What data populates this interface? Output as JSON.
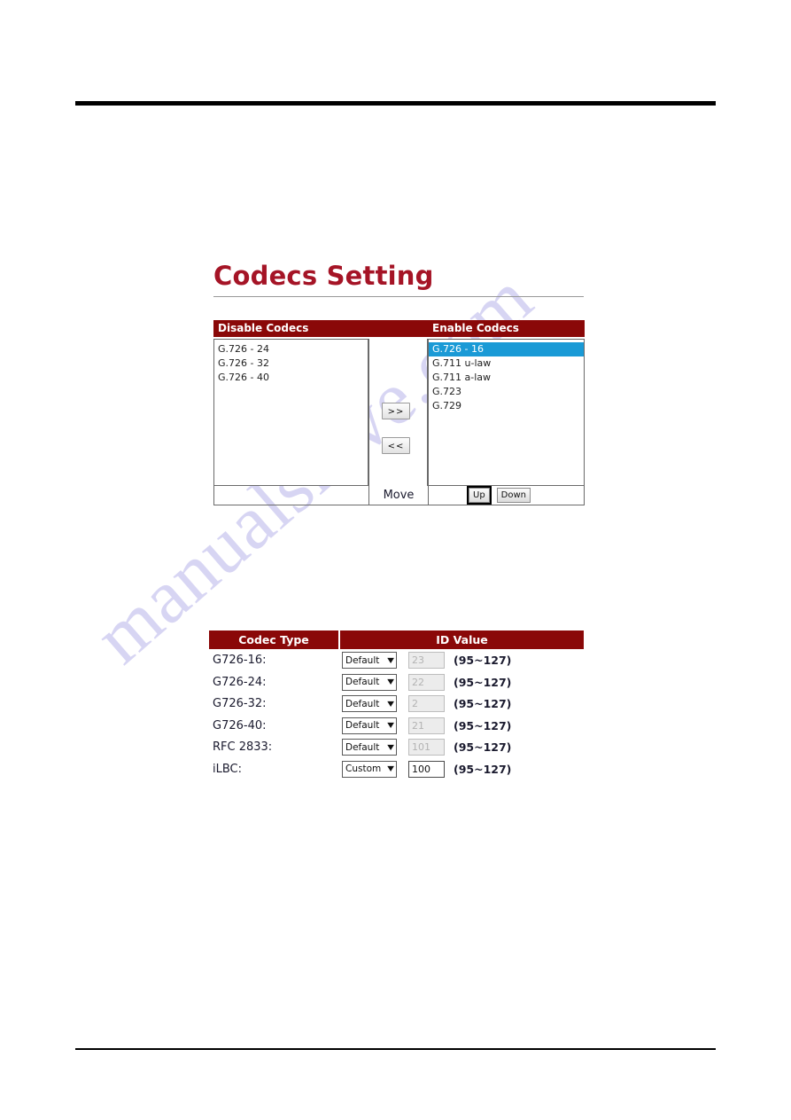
{
  "page": {
    "title": "Codecs Setting",
    "title_color": "#a51426",
    "header_bg": "#8a0808",
    "selection_color": "#1a9ad6",
    "watermark": "manualshive.com"
  },
  "transfer": {
    "headers": {
      "disable": "Disable Codecs",
      "middle": "",
      "enable": "Enable Codecs"
    },
    "disable_list": [
      {
        "label": "G.726 - 24",
        "selected": false
      },
      {
        "label": "G.726 - 32",
        "selected": false
      },
      {
        "label": "G.726 - 40",
        "selected": false
      }
    ],
    "enable_list": [
      {
        "label": "G.726 - 16",
        "selected": true
      },
      {
        "label": "G.711 u-law",
        "selected": false
      },
      {
        "label": "G.711 a-law",
        "selected": false
      },
      {
        "label": "G.723",
        "selected": false
      },
      {
        "label": "G.729",
        "selected": false
      }
    ],
    "buttons": {
      "forward": ">>",
      "backward": "<<",
      "move_label": "Move",
      "up": "Up",
      "down": "Down"
    }
  },
  "id_table": {
    "headers": {
      "codec_type": "Codec Type",
      "id_value": "ID Value"
    },
    "rows": [
      {
        "codec": "G726-16:",
        "mode": "Default",
        "id": "23",
        "id_enabled": false,
        "range": "(95~127)"
      },
      {
        "codec": "G726-24:",
        "mode": "Default",
        "id": "22",
        "id_enabled": false,
        "range": "(95~127)"
      },
      {
        "codec": "G726-32:",
        "mode": "Default",
        "id": "2",
        "id_enabled": false,
        "range": "(95~127)"
      },
      {
        "codec": "G726-40:",
        "mode": "Default",
        "id": "21",
        "id_enabled": false,
        "range": "(95~127)"
      },
      {
        "codec": "RFC 2833:",
        "mode": "Default",
        "id": "101",
        "id_enabled": false,
        "range": "(95~127)"
      },
      {
        "codec": "iLBC:",
        "mode": "Custom",
        "id": "100",
        "id_enabled": true,
        "range": "(95~127)"
      }
    ],
    "mode_options": [
      "Default",
      "Custom"
    ]
  }
}
